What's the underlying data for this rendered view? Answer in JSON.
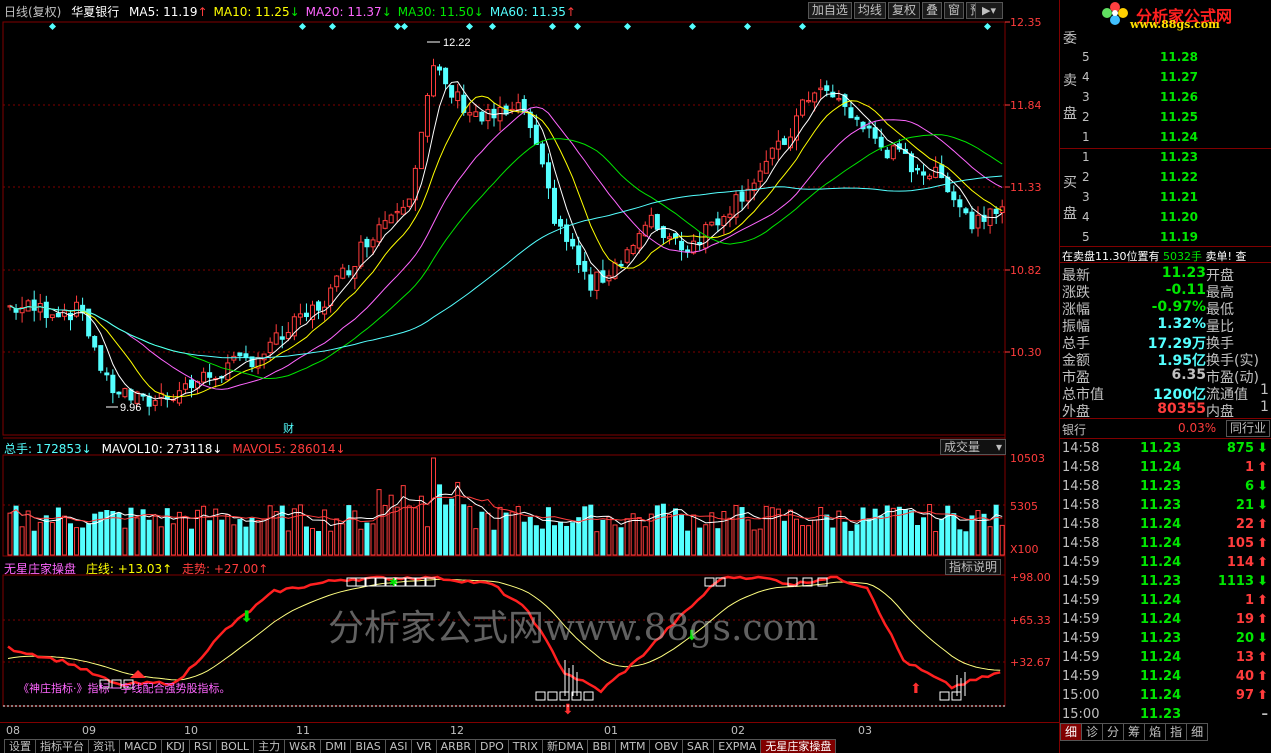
{
  "header": {
    "chart_mode": "日线(复权)",
    "stock_name": "华夏银行",
    "ma": [
      {
        "label": "MA5: 11.19",
        "arrow": "↑",
        "color": "#ffffff"
      },
      {
        "label": "MA10: 11.25",
        "arrow": "↓",
        "color": "#ffff00"
      },
      {
        "label": "MA20: 11.37",
        "arrow": "↓",
        "color": "#ff66ff"
      },
      {
        "label": "MA30: 11.50",
        "arrow": "↓",
        "color": "#00e600"
      },
      {
        "label": "MA60: 11.35",
        "arrow": "↑",
        "color": "#54ffff"
      }
    ],
    "buttons": [
      "加自选",
      "均线",
      "复权",
      "叠",
      "窗",
      "预测"
    ]
  },
  "price_axis": [
    "12.35",
    "11.84",
    "11.33",
    "10.82",
    "10.30"
  ],
  "annotations": {
    "high": "12.22",
    "low": "9.96",
    "cai": "财"
  },
  "volume_panel": {
    "title": "总手: 172853↓",
    "mavol10": "MAVOL10: 273118↓",
    "mavol5": "MAVOL5: 286014↓",
    "select": "成交量",
    "axis": [
      "10503",
      "5305",
      "X100"
    ]
  },
  "indicator_panel": {
    "name": "无星庄家操盘",
    "zx": "庄线: +13.03↑",
    "zs": "走势: +27.00↑",
    "button": "指标说明",
    "axis": [
      "+98.00",
      "+65.33",
      "+32.67"
    ],
    "note": "《神庄指标·》指标一字线配合强势股指标。",
    "watermark": "分析家公式网www.88gs.com"
  },
  "months": [
    "08",
    "09",
    "10",
    "11",
    "12",
    "01",
    "02",
    "03"
  ],
  "tabs": [
    "设置",
    "指标平台",
    "资讯",
    "MACD",
    "KDJ",
    "RSI",
    "BOLL",
    "主力",
    "W&R",
    "DMI",
    "BIAS",
    "ASI",
    "VR",
    "ARBR",
    "DPO",
    "TRIX",
    "新DMA",
    "BBI",
    "MTM",
    "OBV",
    "SAR",
    "EXPMA",
    "无星庄家操盘"
  ],
  "right_panel": {
    "logo": "分析家公式网",
    "logo_url": "www.88gs.com",
    "sell_label": [
      "卖",
      "盘"
    ],
    "buy_label": [
      "买",
      "盘"
    ],
    "side_top": "委",
    "sell": [
      {
        "level": "5",
        "price": "11.28"
      },
      {
        "level": "4",
        "price": "11.27"
      },
      {
        "level": "3",
        "price": "11.26"
      },
      {
        "level": "2",
        "price": "11.25"
      },
      {
        "level": "1",
        "price": "11.24"
      }
    ],
    "buy": [
      {
        "level": "1",
        "price": "11.23"
      },
      {
        "level": "2",
        "price": "11.22"
      },
      {
        "level": "3",
        "price": "11.21"
      },
      {
        "level": "4",
        "price": "11.20"
      },
      {
        "level": "5",
        "price": "11.19"
      }
    ],
    "notice": "在卖盘11.30位置有",
    "notice_qty": "5032手",
    "notice_tail": "卖单! 查",
    "info": [
      {
        "k": "最新",
        "v": "11.23",
        "vc": "#00e600",
        "u": "开盘"
      },
      {
        "k": "涨跌",
        "v": "-0.11",
        "vc": "#00e600",
        "u": "最高"
      },
      {
        "k": "涨幅",
        "v": "-0.97%",
        "vc": "#00e600",
        "u": "最低"
      },
      {
        "k": "振幅",
        "v": "1.32%",
        "vc": "#54ffff",
        "u": "量比"
      },
      {
        "k": "总手",
        "v": "17.29万",
        "vc": "#54ffff",
        "u": "换手"
      },
      {
        "k": "金额",
        "v": "1.95亿",
        "vc": "#54ffff",
        "u": "换手(实)"
      },
      {
        "k": "市盈",
        "v": "6.35",
        "vc": "#c0c0c0",
        "u": "市盈(动)"
      },
      {
        "k": "总市值",
        "v": "1200亿",
        "vc": "#54ffff",
        "u": "流通值"
      },
      {
        "k": "外盘",
        "v": "80355",
        "vc": "#ff3c3c",
        "u": "内盘"
      }
    ],
    "right_edge": {
      "ltz": "1",
      "b": "1"
    },
    "sector": "银行",
    "sector_pct": "0.03%",
    "sector_btn": "同行业",
    "ticks": [
      {
        "t": "14:58",
        "p": "11.23",
        "pc": "#00e600",
        "q": "875",
        "dir": "down"
      },
      {
        "t": "14:58",
        "p": "11.24",
        "pc": "#00e600",
        "q": "1",
        "dir": "up"
      },
      {
        "t": "14:58",
        "p": "11.23",
        "pc": "#00e600",
        "q": "6",
        "dir": "down"
      },
      {
        "t": "14:58",
        "p": "11.23",
        "pc": "#00e600",
        "q": "21",
        "dir": "down"
      },
      {
        "t": "14:58",
        "p": "11.24",
        "pc": "#00e600",
        "q": "22",
        "dir": "up"
      },
      {
        "t": "14:58",
        "p": "11.24",
        "pc": "#00e600",
        "q": "105",
        "dir": "up"
      },
      {
        "t": "14:59",
        "p": "11.24",
        "pc": "#00e600",
        "q": "114",
        "dir": "up"
      },
      {
        "t": "14:59",
        "p": "11.23",
        "pc": "#00e600",
        "q": "1113",
        "dir": "down"
      },
      {
        "t": "14:59",
        "p": "11.24",
        "pc": "#00e600",
        "q": "1",
        "dir": "up"
      },
      {
        "t": "14:59",
        "p": "11.24",
        "pc": "#00e600",
        "q": "19",
        "dir": "up"
      },
      {
        "t": "14:59",
        "p": "11.23",
        "pc": "#00e600",
        "q": "20",
        "dir": "down"
      },
      {
        "t": "14:59",
        "p": "11.24",
        "pc": "#00e600",
        "q": "13",
        "dir": "up"
      },
      {
        "t": "14:59",
        "p": "11.24",
        "pc": "#00e600",
        "q": "40",
        "dir": "up"
      },
      {
        "t": "15:00",
        "p": "11.24",
        "pc": "#00e600",
        "q": "97",
        "dir": "up"
      },
      {
        "t": "15:00",
        "p": "11.23",
        "pc": "#00e600",
        "q": "",
        "dir": "flat"
      }
    ],
    "tabs": [
      "细",
      "诊",
      "分",
      "筹",
      "焰",
      "指",
      "细"
    ]
  },
  "colors": {
    "up": "#ff3c3c",
    "down": "#54ffff",
    "grid": "#800000"
  }
}
